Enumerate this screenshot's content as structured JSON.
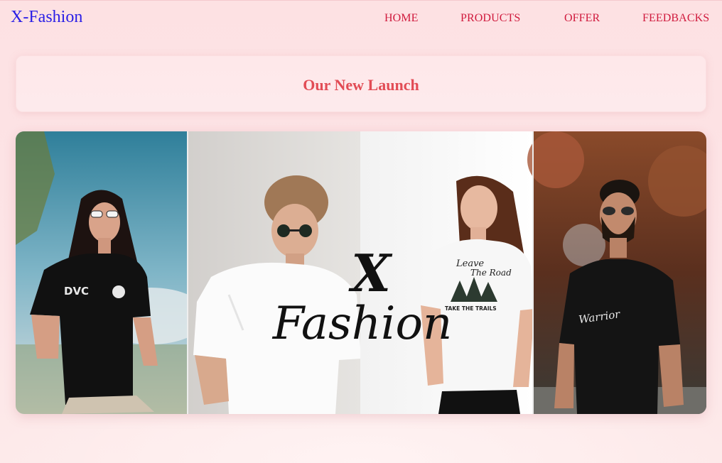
{
  "navbar": {
    "brand": "X-Fashion",
    "links": [
      "HOME",
      "PRODUCTS",
      "OFFER",
      "FEEDBACKS"
    ]
  },
  "launch": {
    "title": "Our New Launch"
  },
  "banner": {
    "overlay_logo_top": "X",
    "overlay_logo_script": "Fashion",
    "shirt_prints": {
      "panel1": "DVC",
      "panel3_line1": "Leave",
      "panel3_line2": "The Road",
      "panel3_line3": "TAKE THE TRAILS",
      "panel4": "Warrior"
    }
  },
  "colors": {
    "brand": "#2a1ee6",
    "nav_link": "#d01a3d",
    "launch_title": "#e24c55",
    "page_background": "#fde1e3"
  }
}
